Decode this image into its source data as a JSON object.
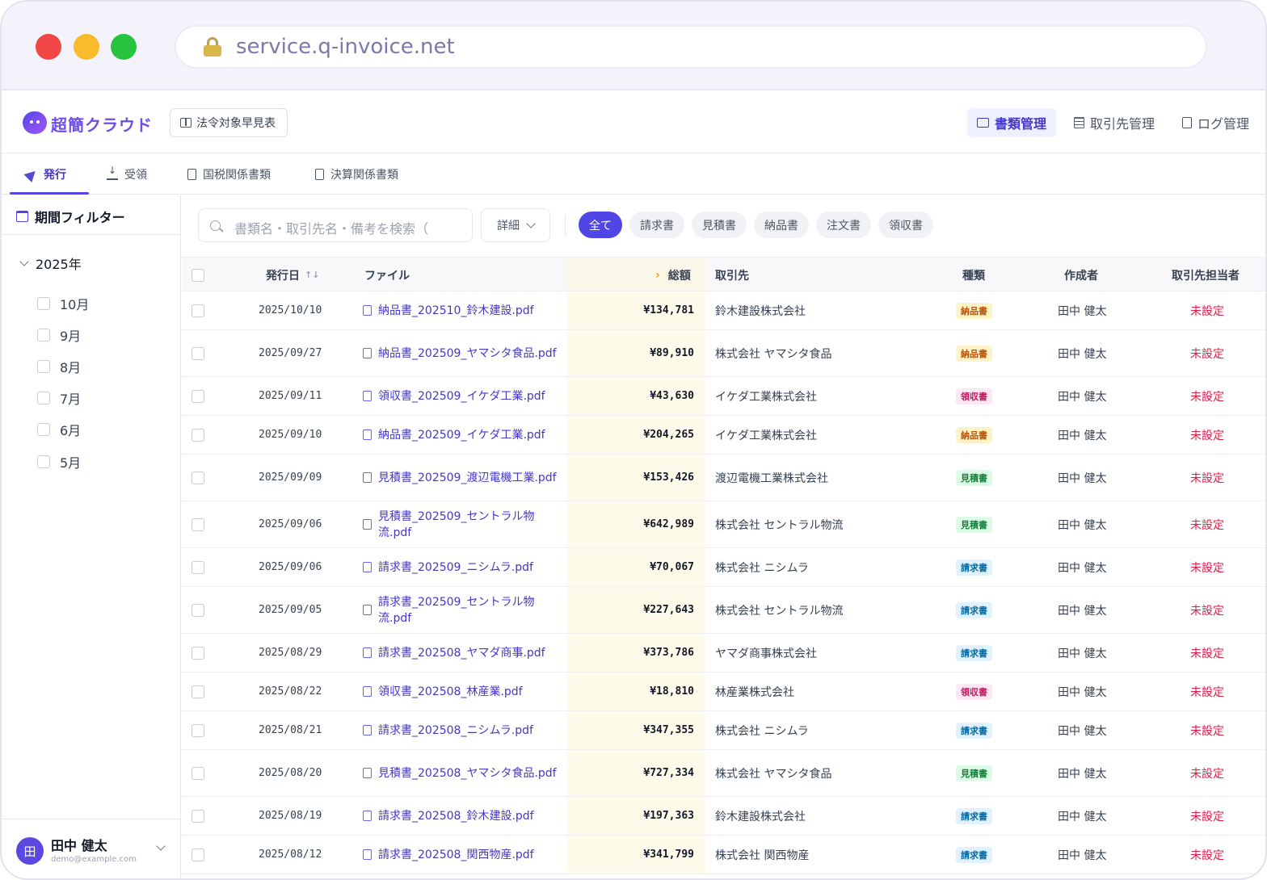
{
  "browser": {
    "url": "service.q-invoice.net"
  },
  "header": {
    "logo": "超簡クラウド",
    "law_button": "法令対象早見表",
    "nav": [
      {
        "label": "書類管理",
        "icon": "folder-icon",
        "active": true
      },
      {
        "label": "取引先管理",
        "icon": "building-icon",
        "active": false
      },
      {
        "label": "ログ管理",
        "icon": "clipboard-icon",
        "active": false
      }
    ]
  },
  "subtabs": [
    {
      "label": "発行",
      "icon": "send-icon",
      "active": true
    },
    {
      "label": "受領",
      "icon": "download-icon",
      "active": false
    },
    {
      "label": "国税関係書類",
      "icon": "document-icon",
      "active": false
    },
    {
      "label": "決算関係書類",
      "icon": "ledger-icon",
      "active": false
    }
  ],
  "sidebar": {
    "title": "期間フィルター",
    "year": "2025年",
    "months": [
      "10月",
      "9月",
      "8月",
      "7月",
      "6月",
      "5月"
    ],
    "user": {
      "initial": "田",
      "name": "田中 健太",
      "email": "demo@example.com"
    }
  },
  "toolbar": {
    "search_placeholder": "書類名・取引先名・備考を検索（",
    "detail_label": "詳細",
    "chips": [
      {
        "label": "全て",
        "active": true
      },
      {
        "label": "請求書",
        "active": false
      },
      {
        "label": "見積書",
        "active": false
      },
      {
        "label": "納品書",
        "active": false
      },
      {
        "label": "注文書",
        "active": false
      },
      {
        "label": "領収書",
        "active": false
      }
    ]
  },
  "table": {
    "headers": {
      "date": "発行日",
      "sort_icon": "↑↓",
      "file": "ファイル",
      "amount_arrow": "›",
      "amount": "総額",
      "partner": "取引先",
      "type": "種類",
      "creator": "作成者",
      "contact": "取引先担当者"
    },
    "rows": [
      {
        "date": "2025/10/10",
        "file": "納品書_202510_鈴木建設.pdf",
        "amount": "¥134,781",
        "partner": "鈴木建設株式会社",
        "type": "納品書",
        "type_class": "b-delivery",
        "creator": "田中 健太",
        "contact": "未設定",
        "h": 48
      },
      {
        "date": "2025/09/27",
        "file": "納品書_202509_ヤマシタ食品.pdf",
        "amount": "¥89,910",
        "partner": "株式会社 ヤマシタ食品",
        "type": "納品書",
        "type_class": "b-delivery",
        "creator": "田中 健太",
        "contact": "未設定",
        "h": 58
      },
      {
        "date": "2025/09/11",
        "file": "領収書_202509_イケダ工業.pdf",
        "amount": "¥43,630",
        "partner": "イケダ工業株式会社",
        "type": "領収書",
        "type_class": "b-receipt",
        "creator": "田中 健太",
        "contact": "未設定",
        "h": 48
      },
      {
        "date": "2025/09/10",
        "file": "納品書_202509_イケダ工業.pdf",
        "amount": "¥204,265",
        "partner": "イケダ工業株式会社",
        "type": "納品書",
        "type_class": "b-delivery",
        "creator": "田中 健太",
        "contact": "未設定",
        "h": 48
      },
      {
        "date": "2025/09/09",
        "file": "見積書_202509_渡辺電機工業.pdf",
        "amount": "¥153,426",
        "partner": "渡辺電機工業株式会社",
        "type": "見積書",
        "type_class": "b-estimate",
        "creator": "田中 健太",
        "contact": "未設定",
        "h": 58
      },
      {
        "date": "2025/09/06",
        "file": "見積書_202509_セントラル物流.pdf",
        "amount": "¥642,989",
        "partner": "株式会社 セントラル物流",
        "type": "見積書",
        "type_class": "b-estimate",
        "creator": "田中 健太",
        "contact": "未設定",
        "h": 58
      },
      {
        "date": "2025/09/06",
        "file": "請求書_202509_ニシムラ.pdf",
        "amount": "¥70,067",
        "partner": "株式会社 ニシムラ",
        "type": "請求書",
        "type_class": "b-invoice",
        "creator": "田中 健太",
        "contact": "未設定",
        "h": 48
      },
      {
        "date": "2025/09/05",
        "file": "請求書_202509_セントラル物流.pdf",
        "amount": "¥227,643",
        "partner": "株式会社 セントラル物流",
        "type": "請求書",
        "type_class": "b-invoice",
        "creator": "田中 健太",
        "contact": "未設定",
        "h": 58
      },
      {
        "date": "2025/08/29",
        "file": "請求書_202508_ヤマダ商事.pdf",
        "amount": "¥373,786",
        "partner": "ヤマダ商事株式会社",
        "type": "請求書",
        "type_class": "b-invoice",
        "creator": "田中 健太",
        "contact": "未設定",
        "h": 48
      },
      {
        "date": "2025/08/22",
        "file": "領収書_202508_林産業.pdf",
        "amount": "¥18,810",
        "partner": "林産業株式会社",
        "type": "領収書",
        "type_class": "b-receipt",
        "creator": "田中 健太",
        "contact": "未設定",
        "h": 48
      },
      {
        "date": "2025/08/21",
        "file": "請求書_202508_ニシムラ.pdf",
        "amount": "¥347,355",
        "partner": "株式会社 ニシムラ",
        "type": "請求書",
        "type_class": "b-invoice",
        "creator": "田中 健太",
        "contact": "未設定",
        "h": 48
      },
      {
        "date": "2025/08/20",
        "file": "見積書_202508_ヤマシタ食品.pdf",
        "amount": "¥727,334",
        "partner": "株式会社 ヤマシタ食品",
        "type": "見積書",
        "type_class": "b-estimate",
        "creator": "田中 健太",
        "contact": "未設定",
        "h": 58
      },
      {
        "date": "2025/08/19",
        "file": "請求書_202508_鈴木建設.pdf",
        "amount": "¥197,363",
        "partner": "鈴木建設株式会社",
        "type": "請求書",
        "type_class": "b-invoice",
        "creator": "田中 健太",
        "contact": "未設定",
        "h": 48
      },
      {
        "date": "2025/08/12",
        "file": "請求書_202508_関西物産.pdf",
        "amount": "¥341,799",
        "partner": "株式会社 関西物産",
        "type": "請求書",
        "type_class": "b-invoice",
        "creator": "田中 健太",
        "contact": "未設定",
        "h": 48
      }
    ]
  }
}
